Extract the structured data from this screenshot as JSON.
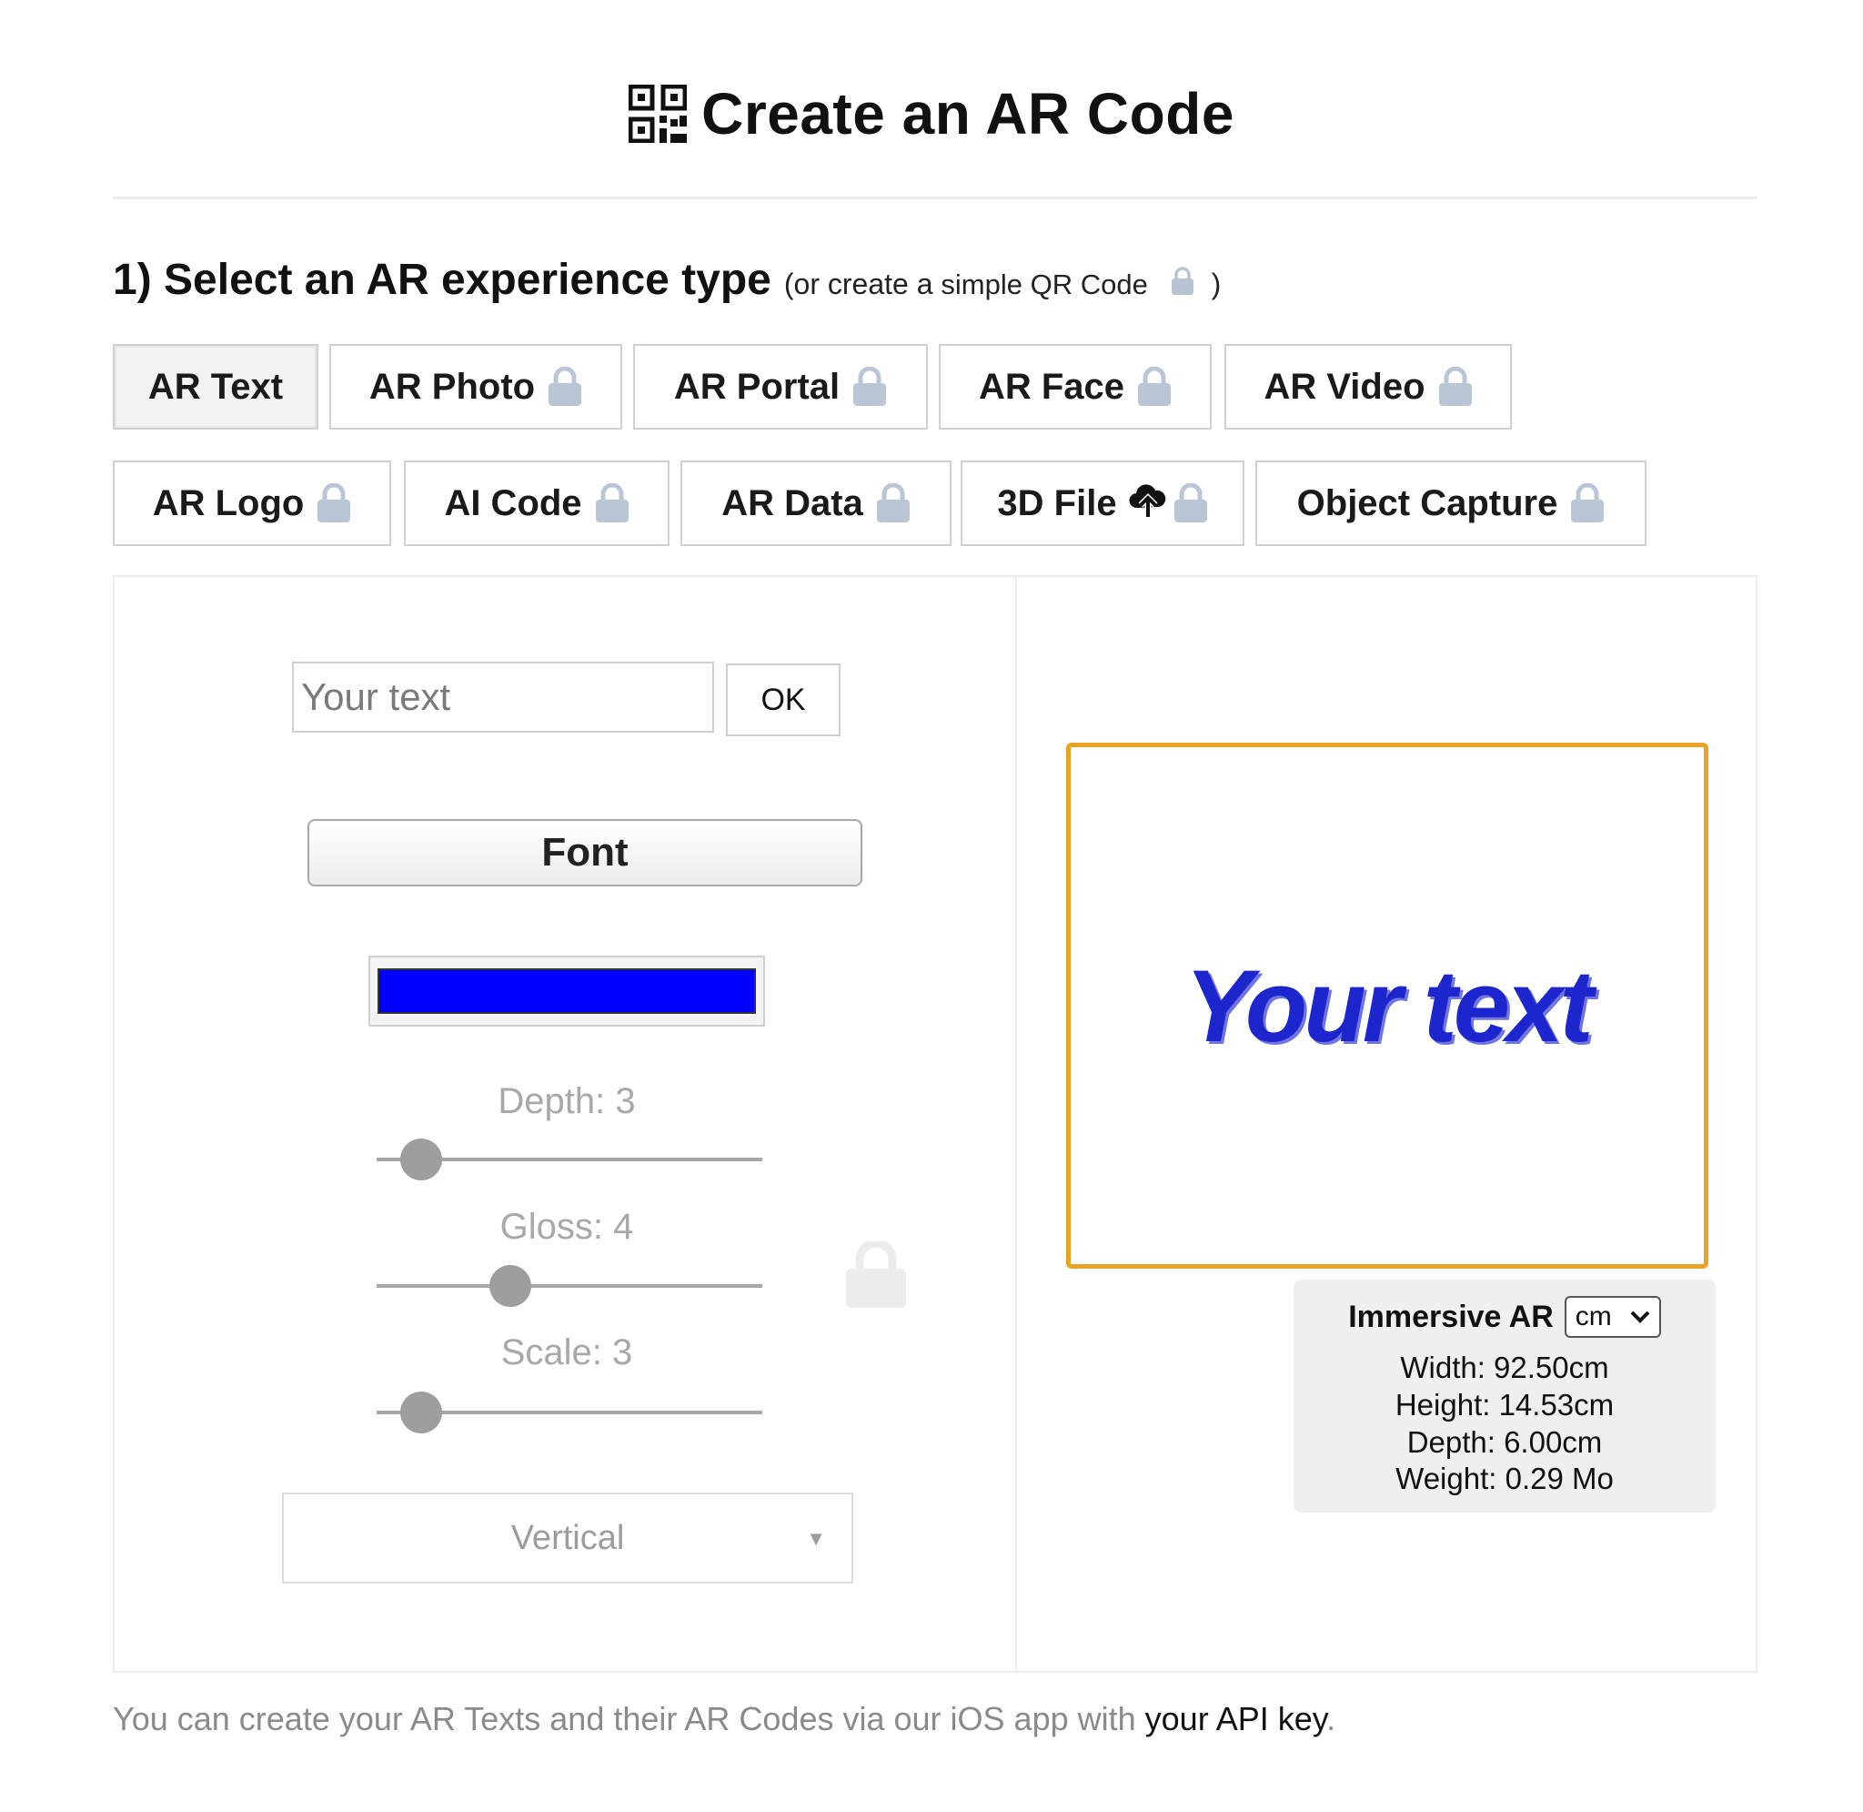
{
  "header": {
    "title": "Create an AR Code",
    "icon": "qr-code-icon"
  },
  "section": {
    "title": "1) Select an AR experience type",
    "aside_prefix": "(or create a",
    "aside_link": "simple QR Code",
    "aside_suffix": ")"
  },
  "tabs_row1": [
    {
      "label": "AR Text",
      "active": true,
      "locked": false
    },
    {
      "label": "AR Photo",
      "locked": true
    },
    {
      "label": "AR Portal",
      "locked": true
    },
    {
      "label": "AR Face",
      "locked": true
    },
    {
      "label": "AR Video",
      "locked": true
    }
  ],
  "tabs_row2": [
    {
      "label": "AR Logo",
      "locked": true
    },
    {
      "label": "AI Code",
      "locked": true
    },
    {
      "label": "AR Data",
      "locked": true
    },
    {
      "label": "3D File",
      "locked": true,
      "extra_icon": "cloud-upload-icon"
    },
    {
      "label": "Object Capture",
      "locked": true
    }
  ],
  "editor": {
    "text_placeholder": "Your text",
    "ok_label": "OK",
    "font_label": "Font",
    "color": "#0000ff",
    "sliders": [
      {
        "label": "Depth: 3",
        "value": 3
      },
      {
        "label": "Gloss: 4",
        "value": 4
      },
      {
        "label": "Scale: 3",
        "value": 3
      }
    ],
    "orientation": "Vertical"
  },
  "preview": {
    "text": "Your text",
    "text_color": "#1d26cc",
    "border_color": "#e8a324"
  },
  "info": {
    "title": "Immersive AR",
    "unit": "cm",
    "width": "Width: 92.50cm",
    "height": "Height: 14.53cm",
    "depth": "Depth: 6.00cm",
    "weight": "Weight: 0.29 Mo"
  },
  "footer": {
    "text": "You can create your AR Texts and their AR Codes via our iOS app with",
    "link": "your API key",
    "end": "."
  }
}
